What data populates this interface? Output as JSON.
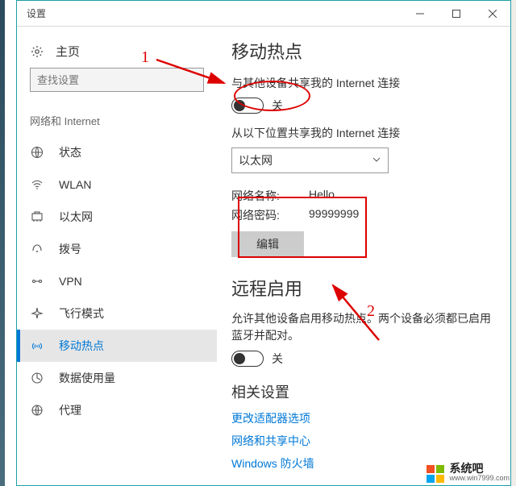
{
  "titlebar": {
    "title": "设置"
  },
  "sidebar": {
    "home_label": "主页",
    "search_placeholder": "查找设置",
    "category_label": "网络和 Internet",
    "items": [
      {
        "label": "状态"
      },
      {
        "label": "WLAN"
      },
      {
        "label": "以太网"
      },
      {
        "label": "拨号"
      },
      {
        "label": "VPN"
      },
      {
        "label": "飞行模式"
      },
      {
        "label": "移动热点"
      },
      {
        "label": "数据使用量"
      },
      {
        "label": "代理"
      }
    ]
  },
  "content": {
    "heading1": "移动热点",
    "share_label": "与其他设备共享我的 Internet 连接",
    "toggle1_state": "关",
    "share_from_label": "从以下位置共享我的 Internet 连接",
    "share_from_value": "以太网",
    "net_name_key": "网络名称:",
    "net_name_val": "Hello",
    "net_pass_key": "网络密码:",
    "net_pass_val": "99999999",
    "edit_label": "编辑",
    "heading2": "远程启用",
    "remote_desc": "允许其他设备启用移动热点。两个设备必须都已启用蓝牙并配对。",
    "toggle2_state": "关",
    "heading3": "相关设置",
    "links": [
      "更改适配器选项",
      "网络和共享中心",
      "Windows 防火墙"
    ]
  },
  "annotations": {
    "label1": "1",
    "label2": "2"
  },
  "watermark": {
    "line1": "系统吧",
    "line2": "www.win7999.com"
  }
}
